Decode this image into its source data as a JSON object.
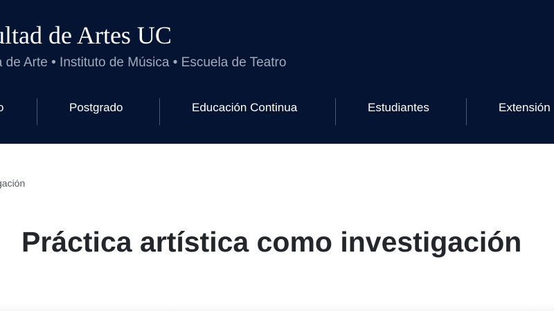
{
  "header": {
    "site_title": "cultad de Artes UC",
    "site_subtitle": "ela de Arte • Instituto de Música • Escuela de Teatro"
  },
  "nav": {
    "items": [
      {
        "label": "o"
      },
      {
        "label": "Postgrado"
      },
      {
        "label": "Educación Continua"
      },
      {
        "label": "Estudiantes"
      },
      {
        "label": "Extensión"
      }
    ]
  },
  "breadcrumb": {
    "current": "tigación"
  },
  "main": {
    "page_title": "Práctica artística como investigación"
  },
  "colors": {
    "header_background": "#041432",
    "subtitle_text": "#a3aabb",
    "title_text": "#23262b"
  }
}
